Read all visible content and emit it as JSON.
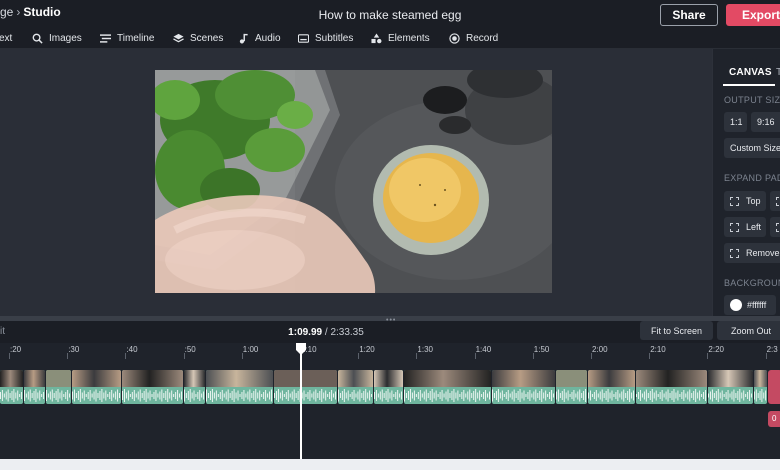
{
  "header": {
    "breadcrumb_prev": "ge",
    "breadcrumb_sep": "›",
    "breadcrumb_current": "Studio",
    "title": "How to make steamed egg",
    "share_label": "Share",
    "export_label": "Export"
  },
  "toolbar": {
    "items": [
      {
        "label": "ext",
        "icon": "text-icon"
      },
      {
        "label": "Images",
        "icon": "search-icon"
      },
      {
        "label": "Timeline",
        "icon": "timeline-icon"
      },
      {
        "label": "Scenes",
        "icon": "layers-icon"
      },
      {
        "label": "Audio",
        "icon": "music-note-icon"
      },
      {
        "label": "Subtitles",
        "icon": "subtitles-icon"
      },
      {
        "label": "Elements",
        "icon": "shapes-icon"
      },
      {
        "label": "Record",
        "icon": "record-icon"
      }
    ]
  },
  "right_panel": {
    "tab_canvas": "CANVAS",
    "tab_next": "T",
    "output_size_label": "OUTPUT SIZE",
    "size_1_1": "1:1",
    "size_9_16": "9:16",
    "custom_size": "Custom Size",
    "expand_padding_label": "EXPAND PADDING",
    "pad_top": "Top",
    "pad_left": "Left",
    "pad_remove": "Remove",
    "background_label": "BACKGROUND",
    "background_color": "#ffffff"
  },
  "timeline": {
    "left_label": "it",
    "current_time": "1:09.99",
    "time_sep": " / ",
    "total_time": "2:33.35",
    "fit_label": "Fit to Screen",
    "zoom_label": "Zoom Out",
    "end_badge": "0",
    "ticks": [
      ":20",
      ":30",
      ":40",
      ":50",
      "1:00",
      "1:10",
      "1:20",
      "1:30",
      "1:40",
      "1:50",
      "2:00",
      "2:10",
      "2:20",
      "2:3"
    ]
  },
  "colors": {
    "accent": "#e34a64",
    "clip": "#6fb59e",
    "end_marker": "#c44a62"
  }
}
